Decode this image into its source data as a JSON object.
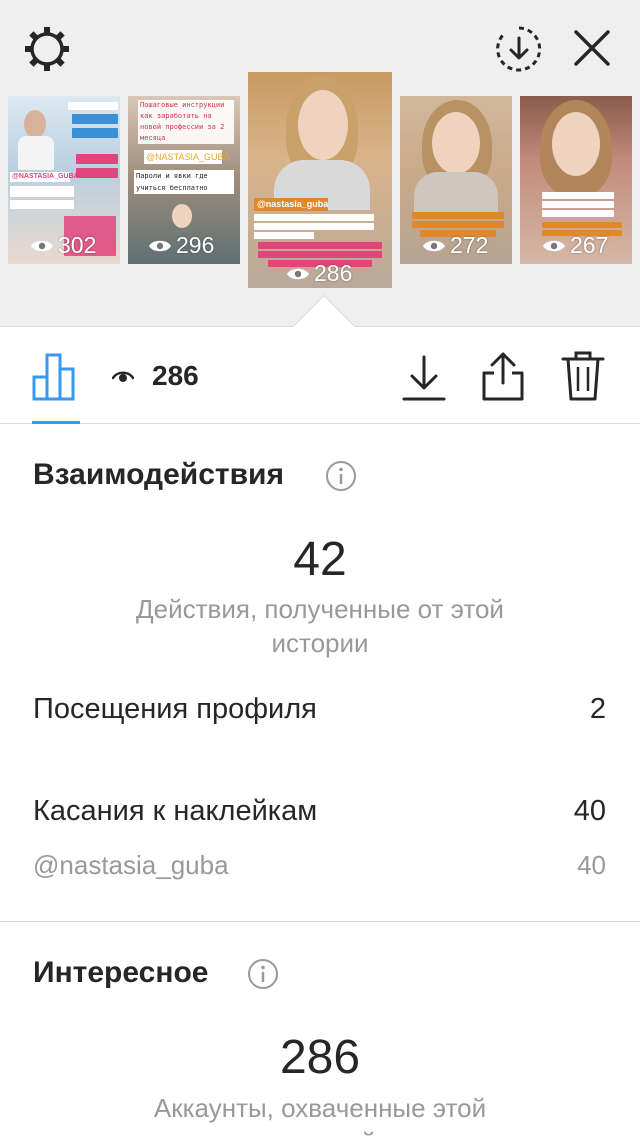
{
  "thumbnails": [
    {
      "views": "302",
      "selected": false
    },
    {
      "views": "296",
      "selected": false
    },
    {
      "views": "286",
      "selected": true
    },
    {
      "views": "272",
      "selected": false
    },
    {
      "views": "267",
      "selected": false
    }
  ],
  "thumb_text": {
    "t1_overlay": "@NASTASIA_GUBA",
    "t2_title": "Пошаговые инструкции как заработать на новой профессии за 2 месяца",
    "t2_handle": "@NASTASIA_GUBA",
    "t2_sub": "Пароли и явки где учиться бесплатно",
    "t3_handle": "@nastasia_guba"
  },
  "toolbar": {
    "views": "286"
  },
  "interactions": {
    "title": "Взаимодействия",
    "total": "42",
    "caption": "Действия, полученные от этой истории",
    "rows": [
      {
        "label": "Посещения профиля",
        "value": "2"
      },
      {
        "label": "Касания к наклейкам",
        "value": "40"
      }
    ],
    "sub_row": {
      "label": "@nastasia_guba",
      "value": "40"
    }
  },
  "discovery": {
    "title": "Интересное",
    "total": "286",
    "caption": "Аккаунты, охваченные этой историей"
  },
  "colors": {
    "accent": "#3897f0",
    "text": "#262626",
    "muted": "#999999",
    "divider": "#dbdbdb"
  },
  "icons": [
    "gear-icon",
    "save-story-icon",
    "close-icon",
    "eye-icon",
    "bar-chart-icon",
    "download-icon",
    "share-icon",
    "trash-icon",
    "info-icon"
  ]
}
